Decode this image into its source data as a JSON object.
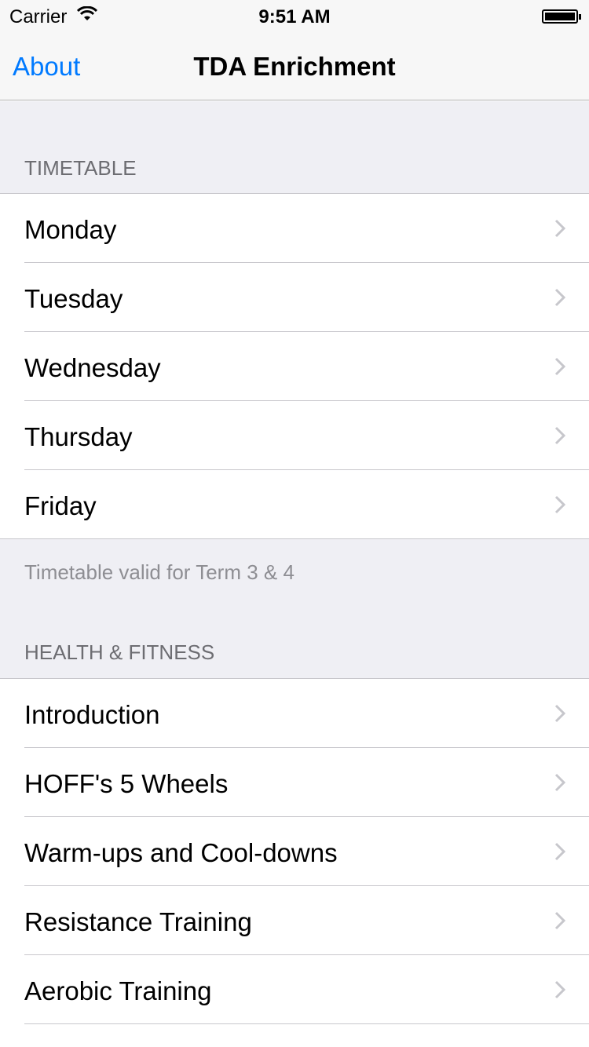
{
  "status_bar": {
    "carrier": "Carrier",
    "time": "9:51 AM"
  },
  "nav": {
    "back_label": "About",
    "title": "TDA Enrichment"
  },
  "sections": [
    {
      "header": "TIMETABLE",
      "items": [
        "Monday",
        "Tuesday",
        "Wednesday",
        "Thursday",
        "Friday"
      ],
      "footer": "Timetable valid for Term 3 & 4"
    },
    {
      "header": "HEALTH & FITNESS",
      "items": [
        "Introduction",
        "HOFF's 5 Wheels",
        "Warm-ups and Cool-downs",
        "Resistance Training",
        "Aerobic Training"
      ]
    }
  ]
}
